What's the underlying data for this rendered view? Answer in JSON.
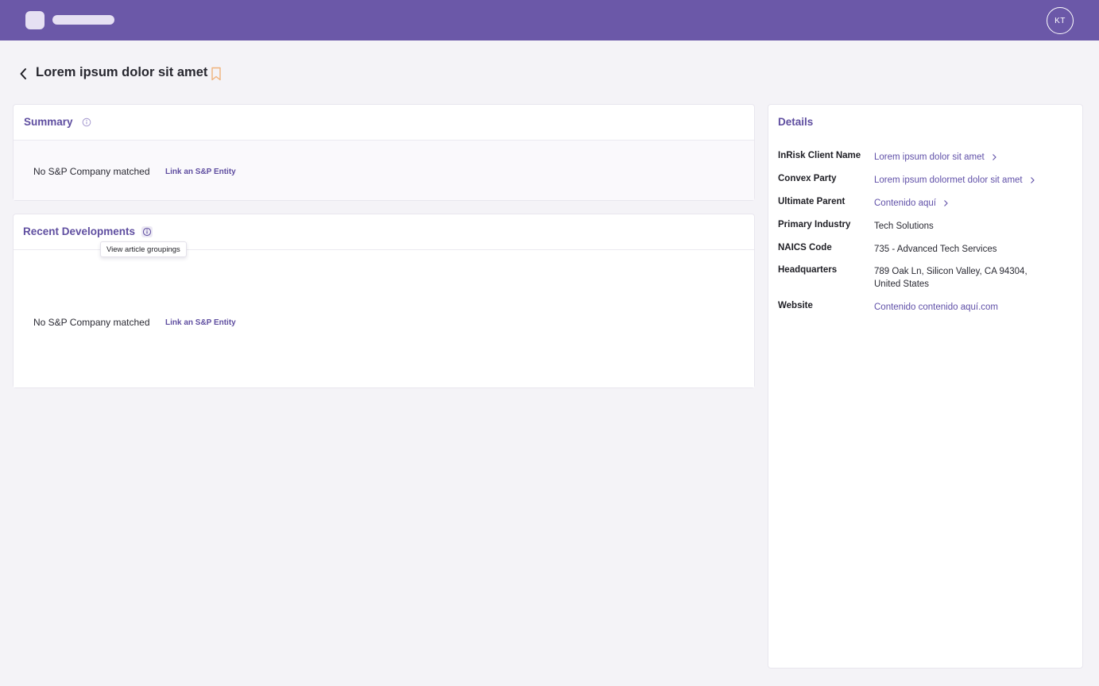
{
  "header": {
    "avatar_initials": "KT"
  },
  "page": {
    "title": "Lorem ipsum dolor sit amet"
  },
  "summary": {
    "title": "Summary",
    "empty_text": "No S&P Company matched",
    "link_label": "Link an S&P Entity"
  },
  "recent": {
    "title": "Recent Developments",
    "tooltip": "View article groupings",
    "empty_text": "No S&P Company matched",
    "link_label": "Link an S&P Entity"
  },
  "details": {
    "title": "Details",
    "rows": [
      {
        "label": "InRisk Client Name",
        "value": "Lorem ipsum dolor sit amet"
      },
      {
        "label": "Convex Party",
        "value": "Lorem ipsum dolormet dolor sit amet"
      },
      {
        "label": "Ultimate Parent",
        "value": "Contenido aquí"
      },
      {
        "label": "Primary Industry",
        "value": "Tech Solutions"
      },
      {
        "label": "NAICS Code",
        "value": "735 - Advanced Tech Services"
      },
      {
        "label": "Headquarters",
        "value_line1": "789 Oak Ln, Silicon Valley, CA 94304,",
        "value_line2": "United States"
      },
      {
        "label": "Website",
        "value": "Contenido contenido aquí.com"
      }
    ]
  },
  "colors": {
    "brand": "#6b58a8",
    "accent_text": "#5f4ea0",
    "bookmark": "#f0b27a",
    "background": "#f4f3f7"
  }
}
